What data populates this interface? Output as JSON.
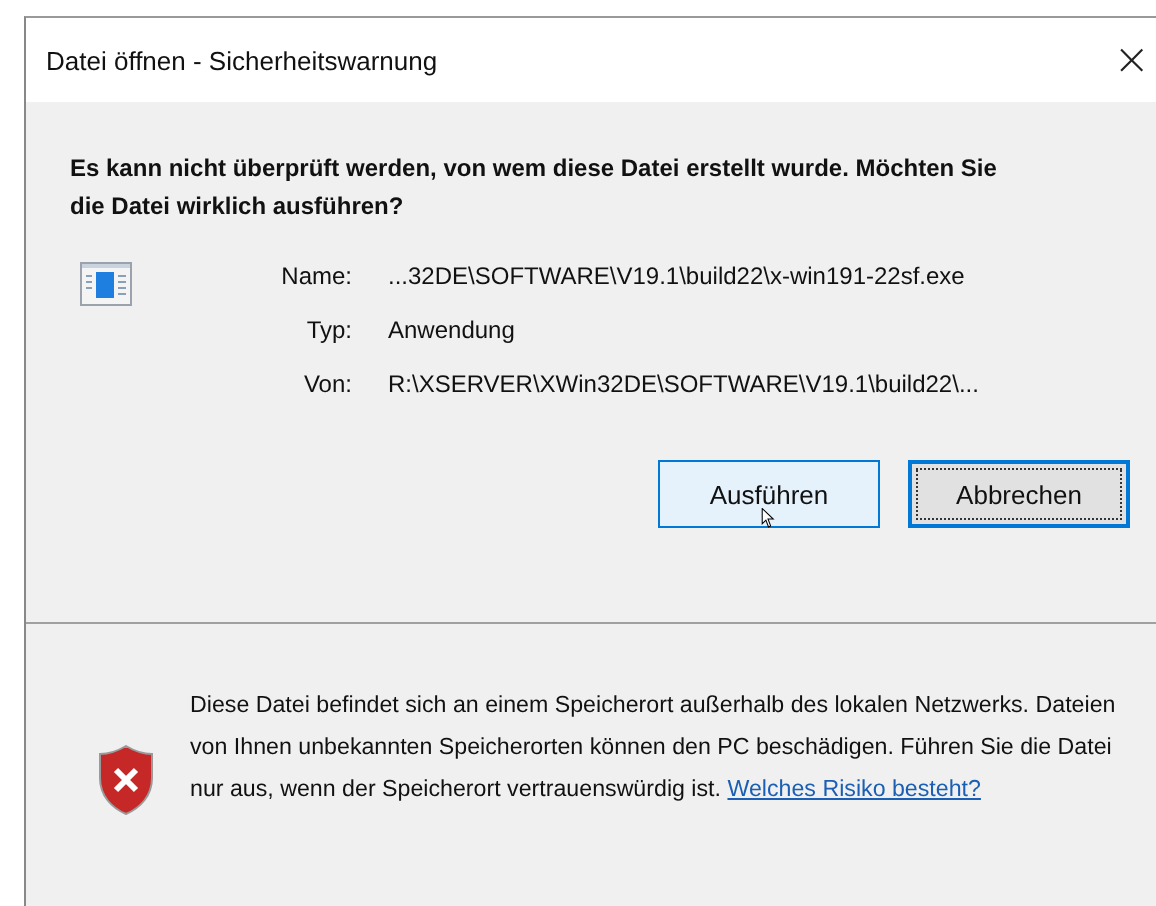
{
  "window": {
    "title": "Datei öffnen - Sicherheitswarnung",
    "close": "×"
  },
  "heading": "Es kann nicht überprüft werden, von wem diese Datei erstellt wurde. Möchten Sie die Datei wirklich ausführen?",
  "fields": [
    {
      "label": "Name:",
      "value": "...32DE\\SOFTWARE\\V19.1\\build22\\x-win191-22sf.exe"
    },
    {
      "label": "Typ:",
      "value": "Anwendung"
    },
    {
      "label": "Von:",
      "value": "R:\\XSERVER\\XWin32DE\\SOFTWARE\\V19.1\\build22\\..."
    }
  ],
  "buttons": [
    {
      "label": "Ausführen",
      "focused": false,
      "hovered": true
    },
    {
      "label": "Abbrechen",
      "focused": true,
      "hovered": false
    }
  ],
  "warning": {
    "text": "Diese Datei befindet sich an einem Speicherort außerhalb des lokalen Netzwerks. Dateien von Ihnen unbekannten Speicherorten können den PC beschädigen. Führen Sie die Datei nur aus, wenn der Speicherort vertrauenswürdig ist.",
    "link": "Welches Risiko besteht?"
  }
}
